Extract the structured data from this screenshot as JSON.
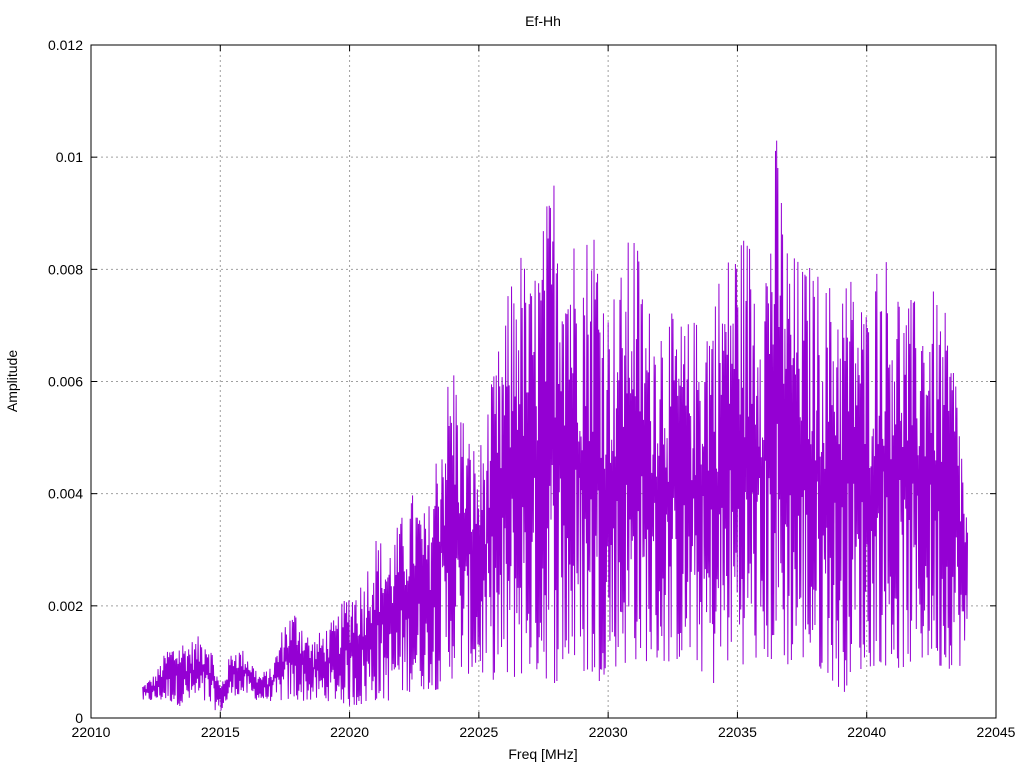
{
  "chart_data": {
    "type": "line",
    "title": "Ef-Hh",
    "xlabel": "Freq [MHz]",
    "ylabel": "Amplitude",
    "xlim": [
      22010,
      22045
    ],
    "ylim": [
      0,
      0.012
    ],
    "xticks": [
      22010,
      22015,
      22020,
      22025,
      22030,
      22035,
      22040,
      22045
    ],
    "xtick_labels": [
      "22010",
      "22015",
      "22020",
      "22025",
      "22030",
      "22035",
      "22040",
      "22045"
    ],
    "yticks": [
      0,
      0.002,
      0.004,
      0.006,
      0.008,
      0.01,
      0.012
    ],
    "ytick_labels": [
      "0",
      "0.002",
      "0.004",
      "0.006",
      "0.008",
      "0.01",
      "0.012"
    ],
    "grid": true,
    "series": [
      {
        "color": "#9400d3",
        "x": [
          22012.0,
          22012.5,
          22013.0,
          22013.5,
          22014.0,
          22014.5,
          22015.0,
          22015.5,
          22016.0,
          22016.5,
          22017.0,
          22017.5,
          22018.0,
          22018.5,
          22019.0,
          22019.5,
          22020.0,
          22020.5,
          22021.0,
          22021.5,
          22022.0,
          22022.5,
          22023.0,
          22023.5,
          22024.0,
          22024.5,
          22025.0,
          22025.5,
          22026.0,
          22026.5,
          22027.0,
          22027.5,
          22028.0,
          22028.5,
          22029.0,
          22029.5,
          22030.0,
          22030.5,
          22031.0,
          22031.5,
          22032.0,
          22032.5,
          22033.0,
          22033.5,
          22034.0,
          22034.5,
          22035.0,
          22035.5,
          22036.0,
          22036.5,
          22037.0,
          22037.5,
          22038.0,
          22038.5,
          22039.0,
          22039.5,
          22040.0,
          22040.5,
          22041.0,
          22041.5,
          22042.0,
          22042.5,
          22043.0,
          22043.5,
          22043.9
        ],
        "envelope_low": [
          0.0003,
          0.0003,
          0.0003,
          0.0002,
          0.0003,
          0.0002,
          0.0001,
          0.0004,
          0.0004,
          0.0003,
          0.0003,
          0.0003,
          0.0003,
          0.0003,
          0.0003,
          0.0003,
          0.0002,
          0.0002,
          0.0003,
          0.0003,
          0.0004,
          0.0005,
          0.0005,
          0.0005,
          0.0007,
          0.0008,
          0.0007,
          0.0007,
          0.0005,
          0.0007,
          0.0008,
          0.0007,
          0.0006,
          0.0008,
          0.0008,
          0.0005,
          0.0009,
          0.0009,
          0.001,
          0.001,
          0.0009,
          0.001,
          0.001,
          0.0009,
          0.0005,
          0.0009,
          0.001,
          0.0009,
          0.001,
          0.0009,
          0.0009,
          0.001,
          0.0008,
          0.0008,
          0.0003,
          0.0009,
          0.0008,
          0.001,
          0.0008,
          0.0009,
          0.0009,
          0.001,
          0.0008,
          0.001,
          0.0007
        ],
        "envelope_high": [
          0.0006,
          0.0008,
          0.0013,
          0.0014,
          0.0014,
          0.0016,
          0.0006,
          0.0013,
          0.0012,
          0.0008,
          0.0009,
          0.0018,
          0.002,
          0.0014,
          0.0016,
          0.0018,
          0.0024,
          0.0025,
          0.0033,
          0.0031,
          0.0036,
          0.0041,
          0.0036,
          0.0054,
          0.0066,
          0.0052,
          0.0048,
          0.006,
          0.0072,
          0.0087,
          0.0078,
          0.0089,
          0.0102,
          0.0089,
          0.0086,
          0.0092,
          0.0075,
          0.008,
          0.009,
          0.0074,
          0.0075,
          0.0072,
          0.0071,
          0.0072,
          0.0078,
          0.0082,
          0.0088,
          0.0087,
          0.0082,
          0.0105,
          0.0084,
          0.0082,
          0.0081,
          0.0078,
          0.0081,
          0.008,
          0.0074,
          0.0085,
          0.0082,
          0.0075,
          0.0075,
          0.0077,
          0.0073,
          0.0062,
          0.0036
        ]
      }
    ]
  }
}
